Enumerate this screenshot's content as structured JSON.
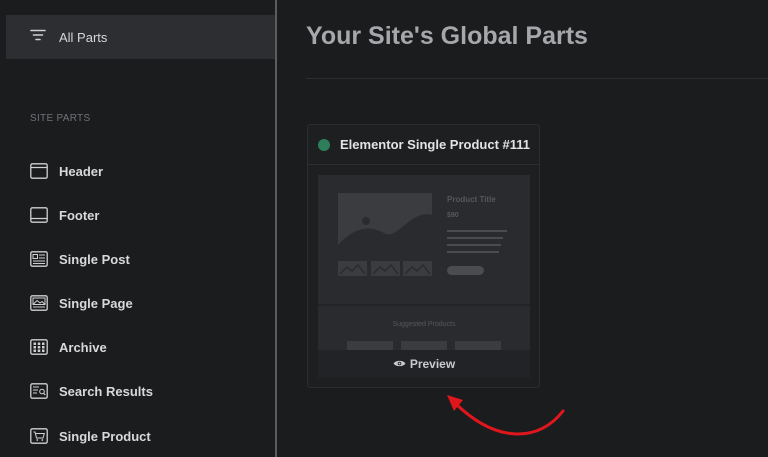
{
  "sidebar": {
    "all_parts_label": "All Parts",
    "section_label": "SITE PARTS",
    "items": [
      {
        "label": "Header",
        "icon": "header-icon"
      },
      {
        "label": "Footer",
        "icon": "footer-icon"
      },
      {
        "label": "Single Post",
        "icon": "single-post-icon"
      },
      {
        "label": "Single Page",
        "icon": "single-page-icon"
      },
      {
        "label": "Archive",
        "icon": "archive-icon"
      },
      {
        "label": "Search Results",
        "icon": "search-results-icon"
      },
      {
        "label": "Single Product",
        "icon": "single-product-icon"
      }
    ]
  },
  "main": {
    "title": "Your Site's Global Parts",
    "card": {
      "title": "Elementor Single Product #111",
      "status_color": "#2e7e5b",
      "thumbnail": {
        "product_title": "Product Title",
        "price": "$90",
        "suggested_label": "Suggested Products"
      },
      "preview_label": "Preview"
    }
  },
  "colors": {
    "annotation_arrow": "#e0161d",
    "background": "#1b1c1e"
  }
}
